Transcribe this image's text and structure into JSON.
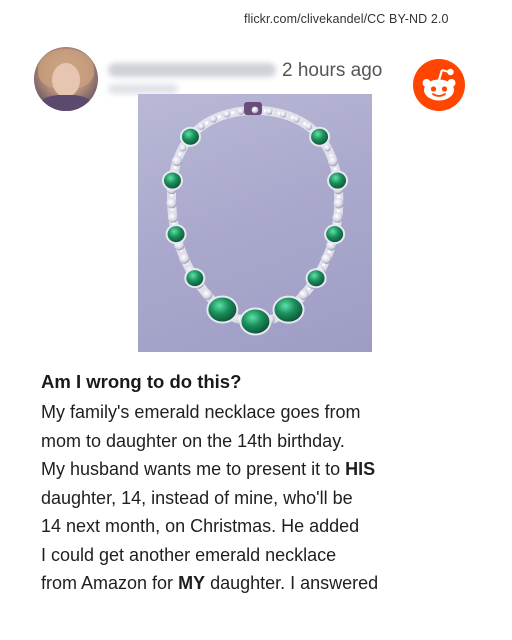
{
  "credit": "flickr.com/clivekandel/CC BY-ND 2.0",
  "post": {
    "timestamp": "2 hours ago",
    "title": "Am I wrong to do this?",
    "lines": [
      [
        "My family's emerald necklace goes from"
      ],
      [
        "mom to daughter on the 14th birthday."
      ],
      [
        "My husband wants me to present it to ",
        "HIS"
      ],
      [
        "daughter, 14, instead of mine, who'll be"
      ],
      [
        "14 next month, on Christmas. He added"
      ],
      [
        "I could get another emerald necklace"
      ],
      [
        "from Amazon for ",
        "MY",
        " daughter. I answered"
      ]
    ]
  },
  "icons": {
    "avatar": "user-avatar-photo",
    "logo": "reddit-logo-icon",
    "photo": "emerald-necklace-photo"
  },
  "colors": {
    "reddit_orange": "#ff4500",
    "emerald": "#1a8f5c"
  }
}
